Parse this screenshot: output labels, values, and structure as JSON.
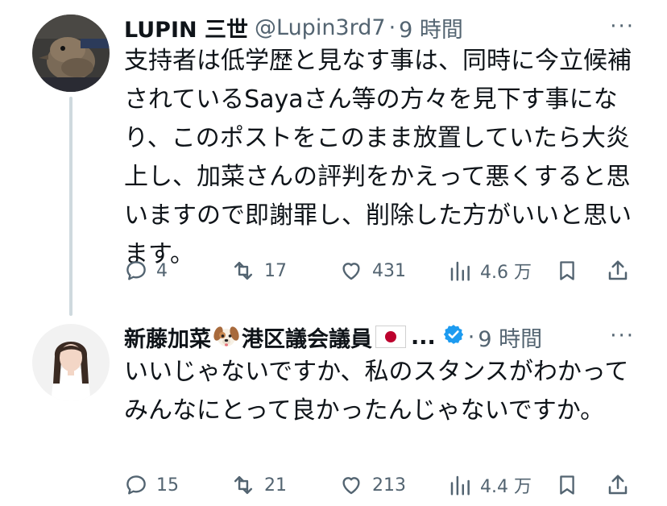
{
  "tweets": [
    {
      "name": "LUPIN 三世",
      "handle": "@Lupin3rd7",
      "separator": "·",
      "time": "9 時間",
      "more": "···",
      "text": "支持者は低学歴と見なす事は、同時に今立候補されているSayaさん等の方々を見下す事になり、このポストをこのまま放置していたら大炎上し、加菜さんの評判をかえって悪くすると思いますので即謝罪し、削除した方がいいと思います。",
      "replies": "4",
      "retweets": "17",
      "likes": "431",
      "views": "4.6 万"
    },
    {
      "name": "新藤加菜",
      "name_suffix": "港区議会議員",
      "ellipsis": "...",
      "separator": "·",
      "time": "9 時間",
      "more": "···",
      "text": "いいじゃないですか、私のスタンスがわかってみんなにとって良かったんじゃないですか。",
      "replies": "15",
      "retweets": "21",
      "likes": "213",
      "views": "4.4 万"
    }
  ],
  "icons": {
    "reply": "reply-icon",
    "retweet": "retweet-icon",
    "like": "heart-icon",
    "views": "analytics-icon",
    "bookmark": "bookmark-icon",
    "share": "share-icon",
    "verified": "verified-badge-icon",
    "dog": "dog-face-emoji",
    "flag": "japan-flag-emoji"
  },
  "colors": {
    "text": "#0f1419",
    "secondary": "#536471",
    "thread_line": "#cfd9de",
    "verified": "#1d9bf0",
    "flag_red": "#bc002d"
  }
}
